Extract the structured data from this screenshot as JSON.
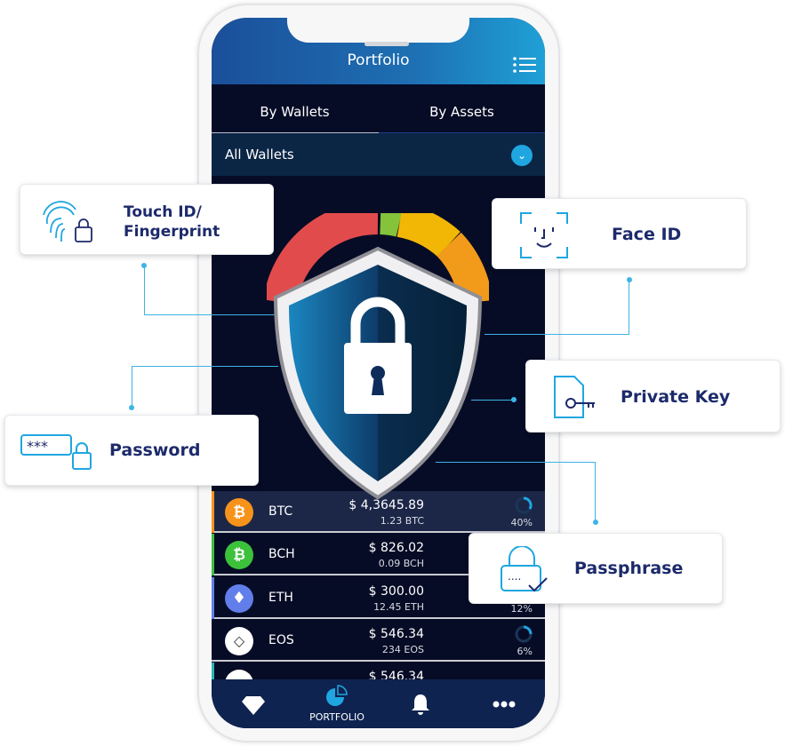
{
  "header": {
    "title": "Portfolio",
    "menu_icon": "list-menu-icon"
  },
  "tabs": [
    {
      "label": "By Wallets",
      "active": true
    },
    {
      "label": "By Assets",
      "active": false
    }
  ],
  "wallet_selector": {
    "value": "All Wallets"
  },
  "assets": [
    {
      "symbol": "BTC",
      "usd": "$ 4,3645.89",
      "amount": "1.23 BTC",
      "percent": "40%",
      "color": "#f7931a",
      "accent": "#f7931a"
    },
    {
      "symbol": "BCH",
      "usd": "$ 826.02",
      "amount": "0.09 BCH",
      "percent": "",
      "color": "#3cc13b",
      "accent": "#3cc13b"
    },
    {
      "symbol": "ETH",
      "usd": "$ 300.00",
      "amount": "12.45 ETH",
      "percent": "12%",
      "color": "#627eea",
      "accent": "#627eea"
    },
    {
      "symbol": "EOS",
      "usd": "$ 546.34",
      "amount": "234 EOS",
      "percent": "6%",
      "color": "#ffffff",
      "accent": "#555"
    },
    {
      "symbol": "",
      "usd": "$ 546.34",
      "amount": "",
      "percent": "",
      "color": "#ffffff",
      "accent": "#2ab5b5"
    }
  ],
  "nav": [
    {
      "icon": "diamond-icon",
      "label": ""
    },
    {
      "icon": "pie-chart-icon",
      "label": "PORTFOLIO"
    },
    {
      "icon": "bell-icon",
      "label": ""
    },
    {
      "icon": "more-icon",
      "label": ""
    }
  ],
  "features": {
    "touch": "Touch ID/\nFingerprint",
    "face": "Face ID",
    "key": "Private Key",
    "password": "Password",
    "passphrase": "Passphrase"
  },
  "colors": {
    "accent": "#1fa6e0",
    "label": "#1c2a6b"
  }
}
